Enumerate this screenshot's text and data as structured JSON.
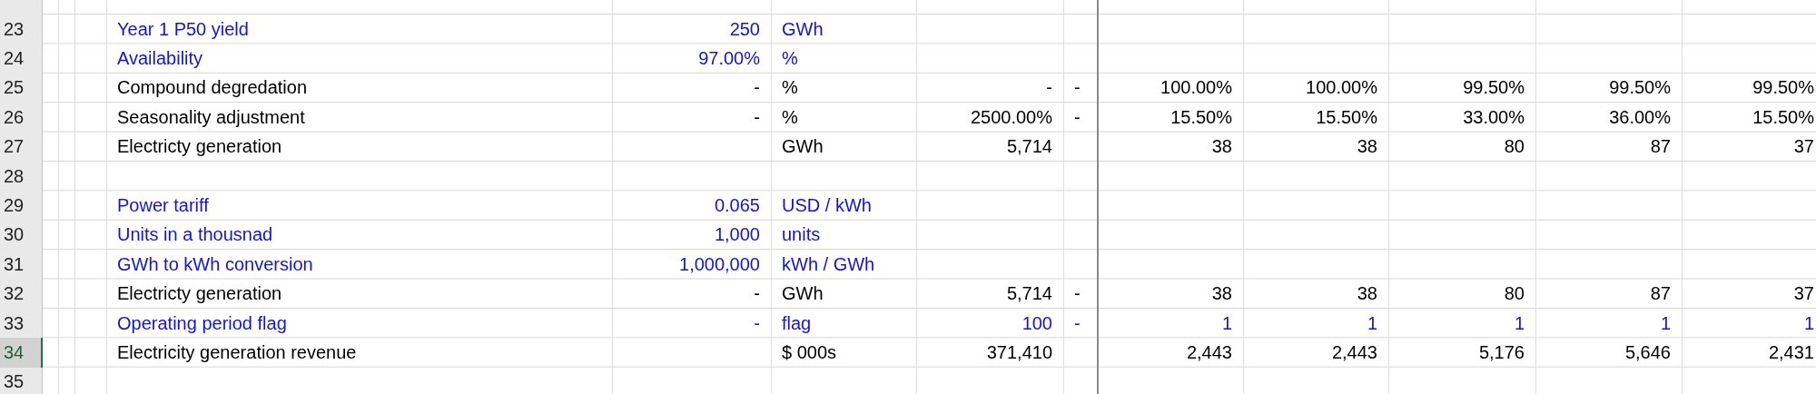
{
  "rows": [
    {
      "number": "23",
      "selected": false,
      "kind": "input",
      "label": "Year 1 P50 yield",
      "value": "250",
      "unit": "GWh"
    },
    {
      "number": "24",
      "selected": false,
      "kind": "input",
      "label": "Availability",
      "value": "97.00%",
      "unit": "%"
    },
    {
      "number": "25",
      "selected": false,
      "kind": "calc",
      "label": "Compound degredation",
      "value": "-",
      "unit": "%",
      "total": "-",
      "flag": "-",
      "periods": [
        "100.00%",
        "100.00%",
        "99.50%",
        "99.50%",
        "99.50%"
      ]
    },
    {
      "number": "26",
      "selected": false,
      "kind": "calc",
      "label": "Seasonality adjustment",
      "value": "-",
      "unit": "%",
      "total": "2500.00%",
      "flag": "-",
      "periods": [
        "15.50%",
        "15.50%",
        "33.00%",
        "36.00%",
        "15.50%"
      ]
    },
    {
      "number": "27",
      "selected": false,
      "kind": "calc",
      "label": "Electricty generation",
      "unit": "GWh",
      "total": "5,714",
      "periods": [
        "38",
        "38",
        "80",
        "87",
        "37"
      ]
    },
    {
      "number": "28",
      "selected": false,
      "kind": "calc"
    },
    {
      "number": "29",
      "selected": false,
      "kind": "input",
      "label": "Power tariff",
      "value": "0.065",
      "unit": "USD / kWh"
    },
    {
      "number": "30",
      "selected": false,
      "kind": "input",
      "label": "Units in a thousnad",
      "value": "1,000",
      "unit": "units"
    },
    {
      "number": "31",
      "selected": false,
      "kind": "input",
      "label": "GWh to kWh conversion",
      "value": "1,000,000",
      "unit": "kWh / GWh"
    },
    {
      "number": "32",
      "selected": false,
      "kind": "calc",
      "label": "Electricty generation",
      "value": "-",
      "unit": "GWh",
      "total": "5,714",
      "flag": "-",
      "periods": [
        "38",
        "38",
        "80",
        "87",
        "37"
      ]
    },
    {
      "number": "33",
      "selected": false,
      "kind": "input",
      "label": "Operating period flag",
      "value": "-",
      "unit": "flag",
      "total": "100",
      "flag": "-",
      "periods": [
        "1",
        "1",
        "1",
        "1",
        "1"
      ]
    },
    {
      "number": "34",
      "selected": true,
      "kind": "calc",
      "label": "Electricity generation revenue",
      "unit": "$ 000s",
      "total": "371,410",
      "periods": [
        "2,443",
        "2,443",
        "5,176",
        "5,646",
        "2,431"
      ]
    },
    {
      "number": "35",
      "selected": false,
      "kind": "calc"
    }
  ]
}
